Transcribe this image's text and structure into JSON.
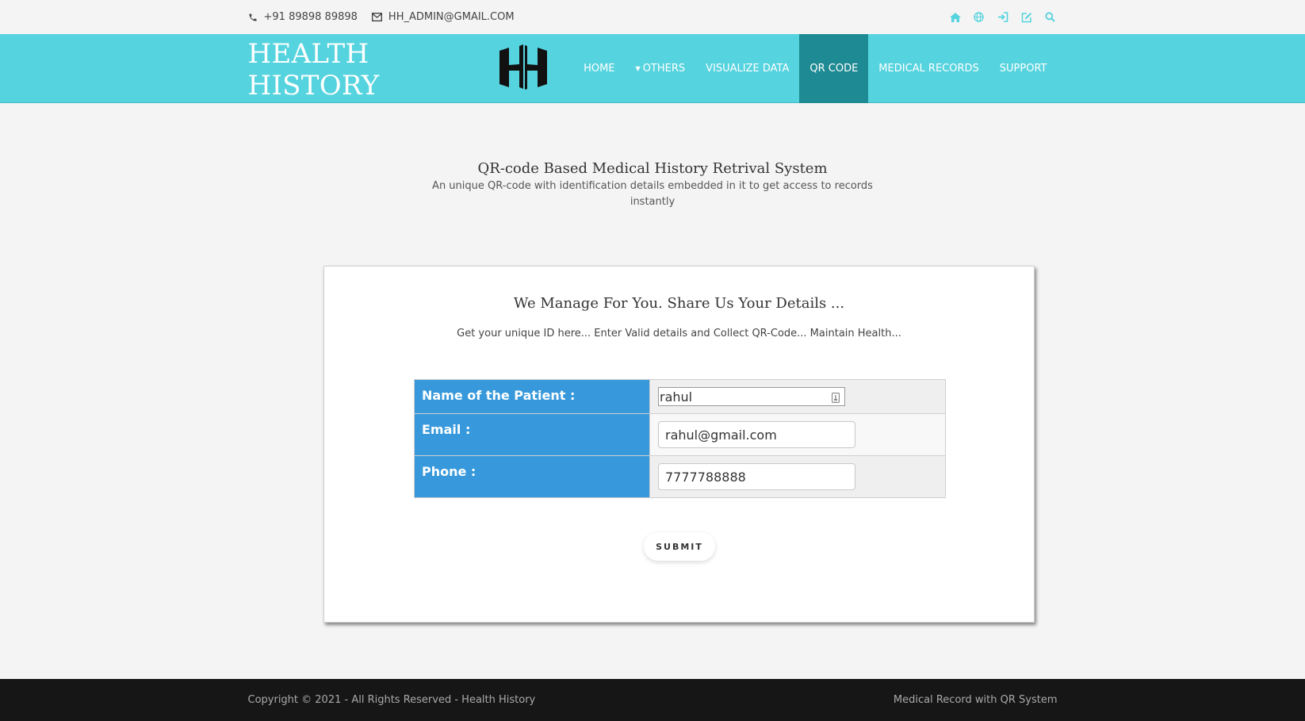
{
  "topbar": {
    "phone": "+91 89898 89898",
    "email": "HH_ADMIN@GMAIL.COM",
    "icons": [
      "home-icon",
      "globe-icon",
      "sign-in-icon",
      "edit-icon",
      "search-icon"
    ],
    "icon_color": "#55d3de"
  },
  "navbar": {
    "brand": "HEALTH HISTORY",
    "logo_text": "HH",
    "items": [
      {
        "label": "HOME"
      },
      {
        "label": "OTHERS"
      },
      {
        "label": "VISUALIZE DATA"
      },
      {
        "label": "QR CODE"
      },
      {
        "label": "MEDICAL RECORDS"
      },
      {
        "label": "SUPPORT"
      }
    ],
    "active": "QR CODE",
    "bg_color": "#55d3de",
    "active_color": "#1e8a93"
  },
  "hero": {
    "title": "QR-code Based Medical History Retrival System",
    "subtitle": "An unique QR-code with identification details embedded in it to get access to records instantly"
  },
  "form": {
    "heading": "We Manage For You. Share Us Your Details ...",
    "subheading": "Get your unique ID here... Enter Valid details and Collect QR-Code... Maintain Health...",
    "fields": [
      {
        "label": "Name of the Patient :",
        "value": "rahul"
      },
      {
        "label": "Email :",
        "value": "rahul@gmail.com"
      },
      {
        "label": "Phone :",
        "value": "7777788888"
      }
    ],
    "label_color": "#3799db",
    "submit_label": "SUBMIT"
  },
  "footer": {
    "copyright": "Copyright © 2021 - All Rights Reserved - Health History",
    "tagline": "Medical Record with QR System"
  }
}
